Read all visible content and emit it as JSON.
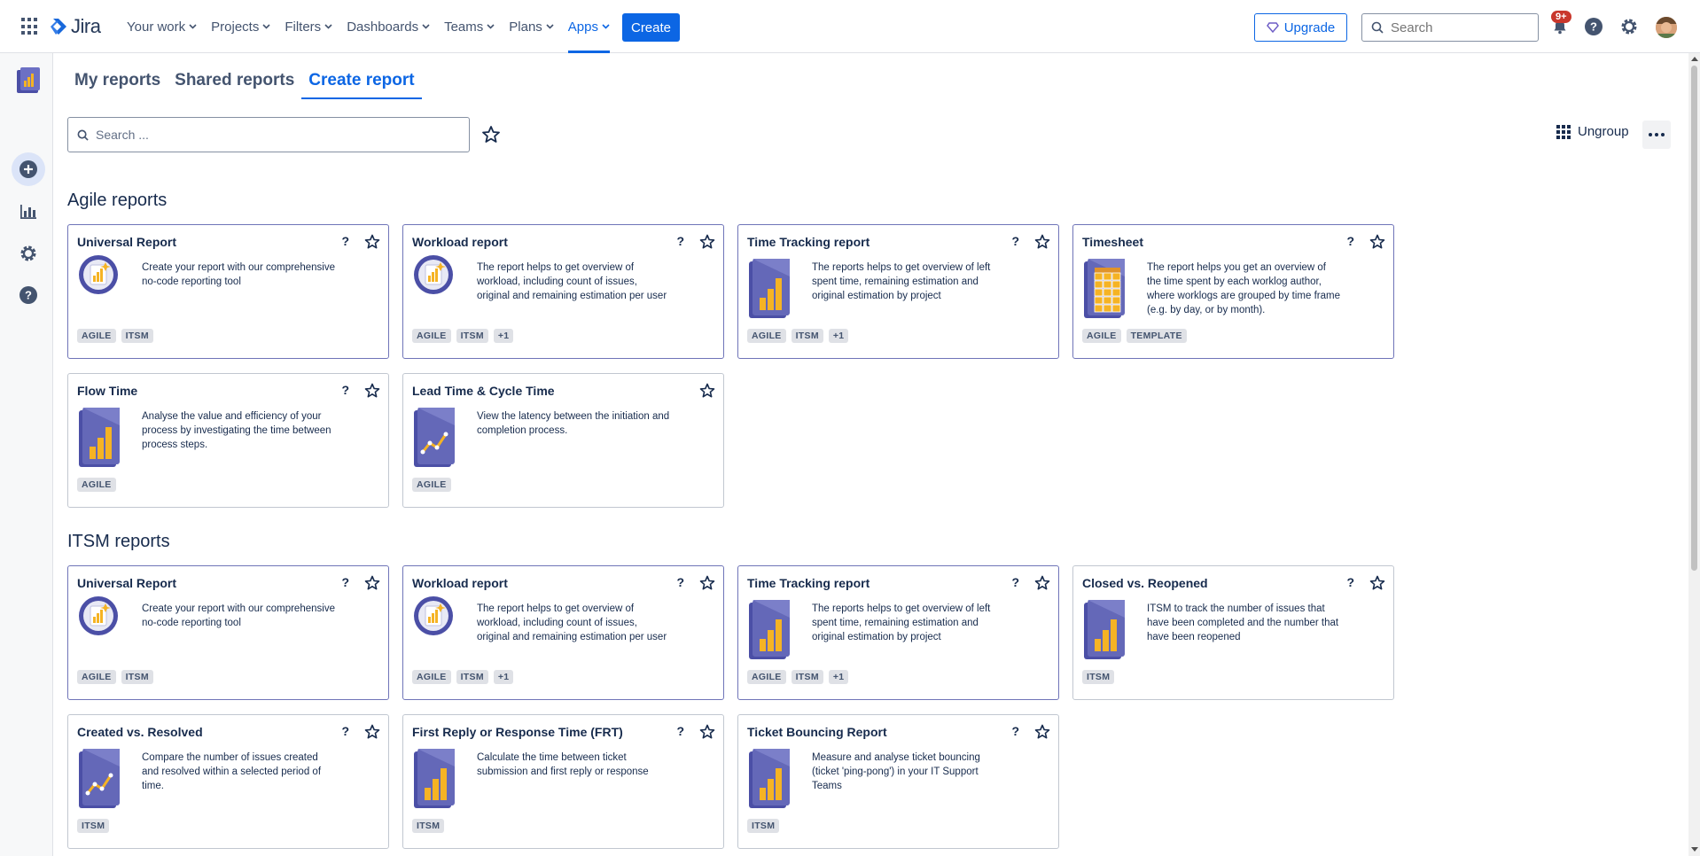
{
  "topnav": {
    "logo": "Jira",
    "items": [
      {
        "label": "Your work"
      },
      {
        "label": "Projects"
      },
      {
        "label": "Filters"
      },
      {
        "label": "Dashboards"
      },
      {
        "label": "Teams"
      },
      {
        "label": "Plans"
      },
      {
        "label": "Apps"
      }
    ],
    "active_item": "Apps",
    "create_label": "Create",
    "upgrade_label": "Upgrade",
    "search_placeholder": "Search",
    "notification_count": "9+"
  },
  "tabs": [
    {
      "label": "My reports"
    },
    {
      "label": "Shared reports"
    },
    {
      "label": "Create report"
    }
  ],
  "active_tab": "Create report",
  "toolbar": {
    "search_placeholder": "Search ...",
    "ungroup_label": "Ungroup"
  },
  "sections": [
    {
      "title": "Agile reports",
      "cards": [
        {
          "title": "Universal Report",
          "help": "?",
          "desc": "Create your report with our comprehensive no-code reporting tool",
          "icon": "universal-report-icon",
          "tags": [
            "AGILE",
            "ITSM"
          ]
        },
        {
          "title": "Workload report",
          "help": "?",
          "desc": "The report helps to get overview of workload, including count of issues, original and remaining estimation per user",
          "icon": "universal-report-icon",
          "tags": [
            "AGILE",
            "ITSM",
            "+1"
          ]
        },
        {
          "title": "Time Tracking report",
          "help": "?",
          "desc": "The reports helps to get overview of left spent time, remaining estimation and original estimation by project",
          "icon": "bar-chart-report-icon",
          "tags": [
            "AGILE",
            "ITSM",
            "+1"
          ]
        },
        {
          "title": "Timesheet",
          "help": "?",
          "desc": "The report helps you get an overview of the time spent by each worklog author, where worklogs are grouped by time frame (e.g. by day, or by month).",
          "icon": "timesheet-grid-icon",
          "tags": [
            "AGILE",
            "TEMPLATE"
          ]
        },
        {
          "title": "Flow Time",
          "help": "?",
          "desc": "Analyse the value and efficiency of your process by investigating the time between process steps.",
          "icon": "bar-chart-report-icon",
          "tags": [
            "AGILE"
          ]
        },
        {
          "title": "Lead Time & Cycle Time",
          "help": "",
          "desc": "View the latency between the initiation and completion process.",
          "icon": "line-chart-report-icon",
          "tags": [
            "AGILE"
          ]
        }
      ]
    },
    {
      "title": "ITSM reports",
      "cards": [
        {
          "title": "Universal Report",
          "help": "?",
          "desc": "Create your report with our comprehensive no-code reporting tool",
          "icon": "universal-report-icon",
          "tags": [
            "AGILE",
            "ITSM"
          ]
        },
        {
          "title": "Workload report",
          "help": "?",
          "desc": "The report helps to get overview of workload, including count of issues, original and remaining estimation per user",
          "icon": "universal-report-icon",
          "tags": [
            "AGILE",
            "ITSM",
            "+1"
          ]
        },
        {
          "title": "Time Tracking report",
          "help": "?",
          "desc": "The reports helps to get overview of left spent time, remaining estimation and original estimation by project",
          "icon": "bar-chart-report-icon",
          "tags": [
            "AGILE",
            "ITSM",
            "+1"
          ]
        },
        {
          "title": "Closed vs. Reopened",
          "help": "?",
          "desc": "ITSM to track the number of issues that have been completed and the number that have been reopened",
          "icon": "bar-chart-report-icon",
          "tags": [
            "ITSM"
          ]
        },
        {
          "title": "Created vs. Resolved",
          "help": "?",
          "desc": "Compare the number of issues created and resolved within a selected period of time.",
          "icon": "line-chart-report-icon",
          "tags": [
            "ITSM"
          ]
        },
        {
          "title": "First Reply or Response Time (FRT)",
          "help": "?",
          "desc": "Calculate the time between ticket submission and first reply or response",
          "icon": "bar-chart-report-icon",
          "tags": [
            "ITSM"
          ]
        },
        {
          "title": "Ticket Bouncing Report",
          "help": "?",
          "desc": "Measure and analyse ticket bouncing (ticket 'ping-pong') in your IT Support Teams",
          "icon": "bar-chart-report-icon",
          "tags": [
            "ITSM"
          ]
        }
      ]
    }
  ],
  "colors": {
    "brand_blue": "#0c66e4",
    "card_highlight_border": "#6f74b8",
    "icon_purple": "#4b4fa6",
    "icon_gold": "#f5b324"
  }
}
